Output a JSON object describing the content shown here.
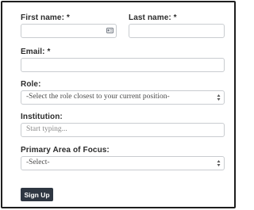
{
  "form": {
    "first_name": {
      "label": "First name: *",
      "value": ""
    },
    "last_name": {
      "label": "Last name: *",
      "value": ""
    },
    "email": {
      "label": "Email: *",
      "value": ""
    },
    "role": {
      "label": "Role:",
      "selected": "-Select the role closest to your current position-"
    },
    "institution": {
      "label": "Institution:",
      "placeholder": "Start typing..."
    },
    "focus": {
      "label": "Primary Area of Focus:",
      "selected": "-Select-"
    },
    "submit_label": "Sign Up"
  },
  "icons": {
    "first_name_field": "contact-card-icon",
    "role_select": "sort-caret-icon",
    "focus_select": "sort-caret-icon"
  }
}
